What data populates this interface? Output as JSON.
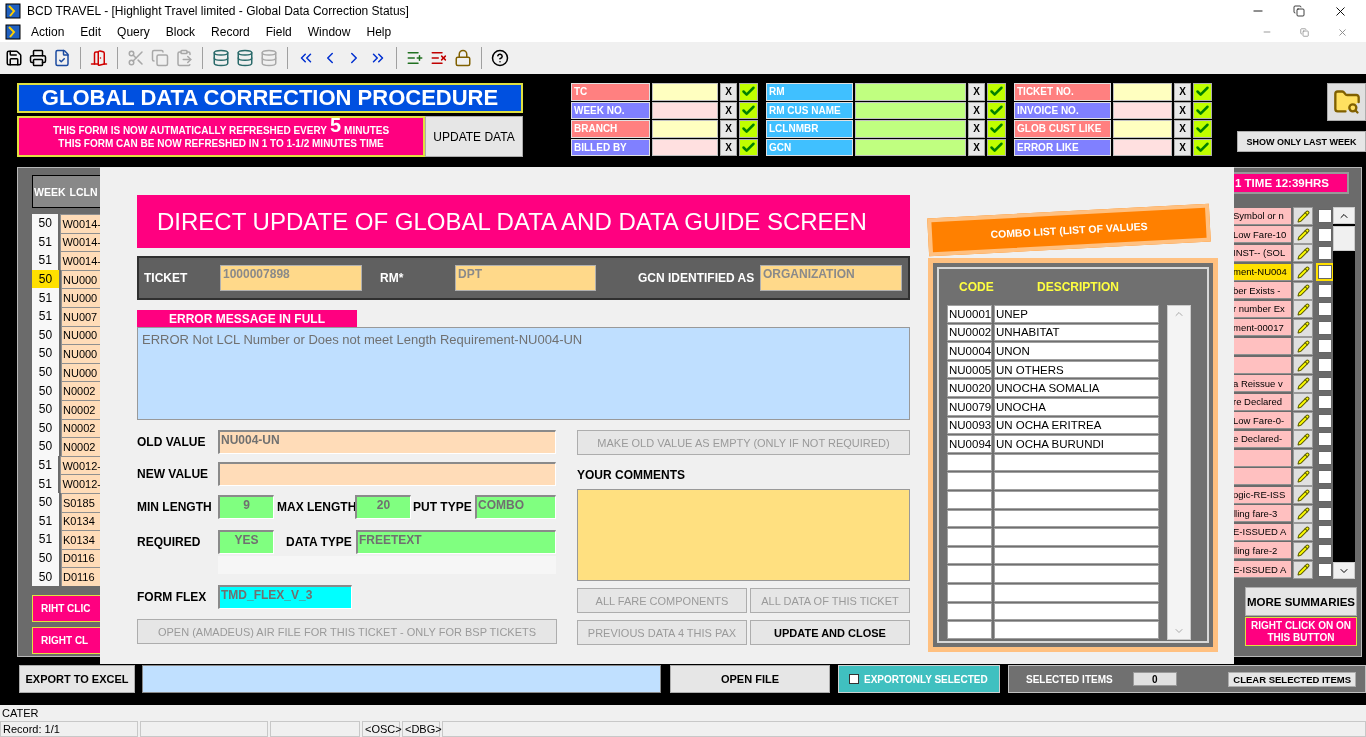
{
  "window": {
    "title": "BCD TRAVEL - [Highlight Travel limited - Global Data Correction Status]"
  },
  "menu": [
    "Action",
    "Edit",
    "Query",
    "Block",
    "Record",
    "Field",
    "Window",
    "Help"
  ],
  "toolbar": [
    {
      "disabled": false
    },
    {
      "disabled": false
    },
    {
      "disabled": false
    },
    {
      "disabled": false
    },
    {
      "disabled": true
    },
    {
      "disabled": true
    },
    {
      "disabled": true
    },
    {
      "disabled": false
    },
    {
      "disabled": false
    },
    {
      "disabled": true
    },
    {
      "disabled": false
    },
    {
      "disabled": false
    },
    {
      "disabled": false
    },
    {
      "disabled": false
    },
    {
      "disabled": false
    },
    {
      "disabled": false
    },
    {
      "disabled": false
    },
    {
      "disabled": false
    }
  ],
  "header": {
    "title": "GLOBAL DATA CORRECTION PROCEDURE",
    "refresh_before": "THIS FORM IS NOW AUTMATICALLY REFRESHED EVERY",
    "refresh_minutes": "5",
    "refresh_after": "MINUTES",
    "refresh_line_2": "THIS FORM CAN BE NOW REFRESHED IN 1 TO 1-1/2 MINUTES TIME",
    "update_button": "UPDATE DATA"
  },
  "filters": [
    {
      "kind": "alternating",
      "items": [
        {
          "label": "TC",
          "color": "#ff8080",
          "clear": "X"
        },
        {
          "label": "WEEK NO.",
          "color": "#8080ff",
          "clear": "X"
        },
        {
          "label": "BRANCH",
          "color": "#ff8080",
          "clear": "X"
        },
        {
          "label": "BILLED BY",
          "color": "#8080ff",
          "clear": "X"
        }
      ]
    },
    {
      "kind": "plain",
      "items": [
        {
          "label": "RM",
          "color": "#40c0ff",
          "clear": "X"
        },
        {
          "label": "RM CUS NAME",
          "color": "#40c0ff",
          "clear": "X"
        },
        {
          "label": "LCLNMBR",
          "color": "#40c0ff",
          "clear": "X"
        },
        {
          "label": "GCN",
          "color": "#40c0ff",
          "clear": "X"
        }
      ]
    },
    {
      "kind": "alternating",
      "items": [
        {
          "label": "TICKET NO.",
          "color": "#ff8080",
          "clear": "X"
        },
        {
          "label": "INVOICE NO.",
          "color": "#8080ff",
          "clear": "X"
        },
        {
          "label": "GLOB CUST LIKE",
          "color": "#ff8080",
          "clear": "X"
        },
        {
          "label": "ERROR LIKE",
          "color": "#8080ff",
          "clear": "X"
        }
      ]
    }
  ],
  "show_last_week": "SHOW ONLY LAST WEEK",
  "table": {
    "columns": [
      "WEEK",
      "LCLN"
    ],
    "time_label": "1 TIME 12:39HRS",
    "rows": [
      {
        "week": "50",
        "lclnmbr": "W0014-",
        "error": "Symbol or n",
        "selected": false,
        "checked": false
      },
      {
        "week": "51",
        "lclnmbr": "W0014-",
        "error": "Low Fare-10",
        "selected": false,
        "checked": false
      },
      {
        "week": "51",
        "lclnmbr": "W0014-",
        "error": "INST-- (SOL",
        "selected": false,
        "checked": false
      },
      {
        "week": "50",
        "lclnmbr": "NU000",
        "error": "ment-NU004",
        "selected": true,
        "checked": false
      },
      {
        "week": "51",
        "lclnmbr": "NU000",
        "error": "ber Exists -",
        "selected": false,
        "checked": false
      },
      {
        "week": "51",
        "lclnmbr": "NU007",
        "error": "r number Ex",
        "selected": false,
        "checked": false
      },
      {
        "week": "50",
        "lclnmbr": "NU000",
        "error": "ment-00017",
        "selected": false,
        "checked": false
      },
      {
        "week": "50",
        "lclnmbr": "NU000",
        "selected": false,
        "checked": false
      },
      {
        "week": "50",
        "lclnmbr": "NU000",
        "selected": false,
        "checked": false
      },
      {
        "week": "50",
        "lclnmbr": "N0002",
        "error": "a Reissue v",
        "selected": false,
        "checked": false
      },
      {
        "week": "50",
        "lclnmbr": "N0002",
        "error": "re Declared",
        "selected": false,
        "checked": false
      },
      {
        "week": "50",
        "lclnmbr": "N0002",
        "error": "Low Fare-0-",
        "selected": false,
        "checked": false
      },
      {
        "week": "50",
        "lclnmbr": "N0002",
        "error": "e Declared-",
        "selected": false,
        "checked": false
      },
      {
        "week": "51",
        "lclnmbr": "W0012-",
        "selected": false,
        "checked": false
      },
      {
        "week": "51",
        "lclnmbr": "W0012-",
        "selected": false,
        "checked": false
      },
      {
        "week": "50",
        "lclnmbr": "S0185",
        "error": "ogic-RE-ISS",
        "selected": false,
        "checked": false
      },
      {
        "week": "51",
        "lclnmbr": "K0134",
        "error": "lling fare-3",
        "selected": false,
        "checked": false
      },
      {
        "week": "51",
        "lclnmbr": "K0134",
        "error": "E-ISSUED A",
        "selected": false,
        "checked": false
      },
      {
        "week": "50",
        "lclnmbr": "D0116",
        "error": "lling fare-2",
        "selected": false,
        "checked": false
      },
      {
        "week": "50",
        "lclnmbr": "D0116",
        "error": "E-ISSUED A",
        "selected": false,
        "checked": false
      }
    ]
  },
  "left_buttons": [
    "RIHT CLIC",
    "RIGHT CL"
  ],
  "more_summaries": "MORE SUMMARIES",
  "right_click_note": "RIGHT CLICK ON ON THIS BUTTON",
  "dialog": {
    "banner": "DIRECT UPDATE OF GLOBAL DATA AND DATA GUIDE SCREEN",
    "ticket_label": "TICKET",
    "ticket": "1000007898",
    "rm_label": "RM*",
    "rm": "DPT",
    "gcn_label": "GCN IDENTIFIED AS",
    "gcn": "ORGANIZATION",
    "error_label": "ERROR MESSAGE IN FULL",
    "error_text": "ERROR Not LCL Number or Does not meet Length Requirement-NU004-UN",
    "old_value_label": "OLD VALUE",
    "old_value": "NU004-UN",
    "new_value_label": "NEW VALUE",
    "min_length_label": "MIN LENGTH",
    "min_length": "9",
    "max_length_label": "MAX LENGTH",
    "max_length": "20",
    "input_type_label": "PUT TYPE",
    "input_type": "COMBO",
    "required_label": "REQUIRED",
    "required": "YES",
    "data_type_label": "DATA TYPE",
    "data_type": "FREETEXT",
    "form_flex_label": "FORM FLEX",
    "form_flex": "TMD_FLEX_V_3",
    "open_air_button": {
      "label": "OPEN (AMADEUS) AIR FILE FOR THIS TICKET - ONLY FOR BSP TICKETS",
      "disabled": true
    },
    "make_empty_button": {
      "label": "MAKE OLD VALUE AS EMPTY (ONLY IF NOT REQUIRED)",
      "disabled": true
    },
    "comments_label": "YOUR COMMENTS",
    "buttons": [
      {
        "label": "ALL FARE COMPONENTS",
        "disabled": true
      },
      {
        "label": "ALL DATA OF THIS TICKET",
        "disabled": true
      },
      {
        "label": "PREVIOUS DATA 4 THIS PAX",
        "disabled": true
      },
      {
        "label": "UPDATE AND CLOSE",
        "disabled": false
      }
    ],
    "combo": {
      "title": "COMBO LIST (LIST OF VALUES",
      "columns": [
        "CODE",
        "DESCRIPTION"
      ],
      "rows": [
        {
          "code": "NU0001",
          "description": "UNEP"
        },
        {
          "code": "NU0002",
          "description": "UNHABITAT"
        },
        {
          "code": "NU0004",
          "description": "UNON"
        },
        {
          "code": "NU0005",
          "description": "UN OTHERS"
        },
        {
          "code": "NU0020",
          "description": "UNOCHA SOMALIA"
        },
        {
          "code": "NU0079",
          "description": "UNOCHA"
        },
        {
          "code": "NU0093",
          "description": "UN OCHA ERITREA"
        },
        {
          "code": "NU0094",
          "description": "UN OCHA BURUNDI"
        }
      ]
    }
  },
  "bottom": {
    "export_button": "EXPORT TO EXCEL",
    "open_file_button": "OPEN FILE",
    "export_selected": {
      "label": "EXPORTONLY SELECTED",
      "checked": false
    },
    "selected_items_label": "SELECTED ITEMS",
    "selected_items": "0",
    "clear_button": "CLEAR SELECTED ITEMS"
  },
  "status": {
    "message": "CATER",
    "record": "Record: 1/1",
    "osc": "<OSC>",
    "dbg": "<DBG>"
  }
}
